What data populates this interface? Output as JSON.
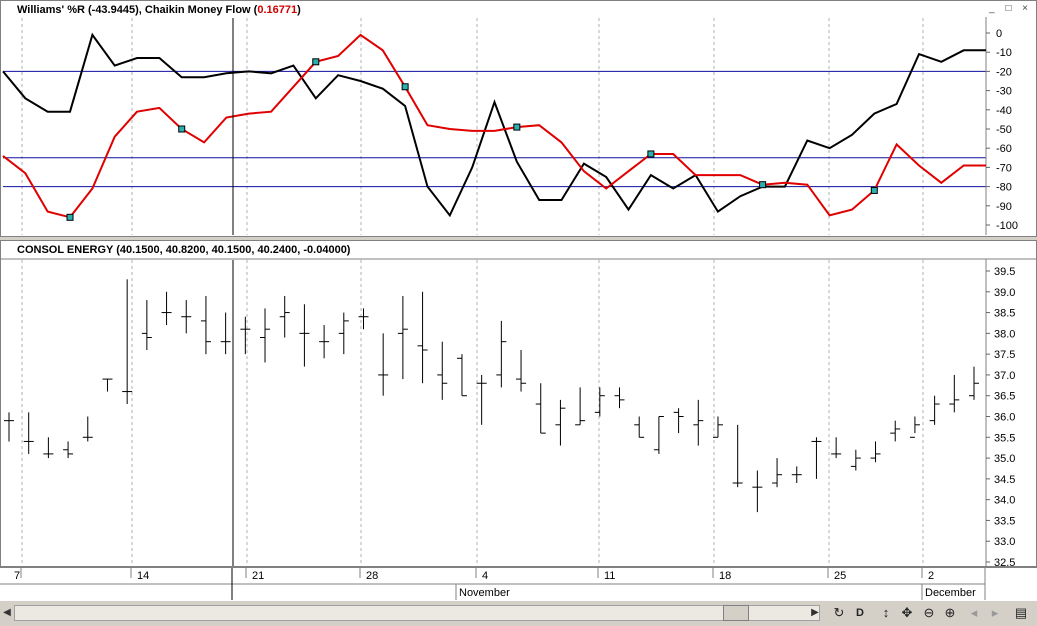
{
  "upper_title": {
    "name1": "Williams' %R (",
    "val1": "-43.9445",
    "mid": "), Chaikin Money Flow (",
    "val2": "0.16771",
    "end": ")"
  },
  "lower_title": "CONSOL ENERGY (40.1500, 40.8200, 40.1500, 40.2400, -0.04000)",
  "window_buttons": "_ □ ×",
  "date_labels": [
    "7",
    "14",
    "21",
    "28",
    "4",
    "11",
    "18",
    "25",
    "2"
  ],
  "month_labels": [
    "November",
    "December"
  ],
  "toolbar": {
    "d_label": "D"
  },
  "chart_data": [
    {
      "type": "line",
      "title": "Williams' %R (-43.9445), Chaikin Money Flow (0.16771)",
      "ylim": [
        -100,
        0
      ],
      "yticks": [
        0,
        -10,
        -20,
        -30,
        -40,
        -50,
        -60,
        -70,
        -80,
        -90,
        -100
      ],
      "reference_lines": [
        -20,
        -65,
        -80
      ],
      "grid": "vertical dashed",
      "series": [
        {
          "color": "#000000",
          "values": [
            -20,
            -34,
            -41,
            -41,
            -1,
            -17,
            -13,
            -13,
            -23,
            -23,
            -21,
            -20,
            -21,
            -17,
            -34,
            -22,
            -25,
            -29,
            -38,
            -80,
            -95,
            -70,
            -36,
            -67,
            -87,
            -87,
            -68,
            -75,
            -92,
            -74,
            -81,
            -74,
            -93,
            -85,
            -80,
            -80,
            -56,
            -60,
            -53,
            -42,
            -37,
            -11,
            -15,
            -9,
            -9
          ]
        },
        {
          "color": "#e00000",
          "values": [
            -64,
            -73,
            -93,
            -96,
            -81,
            -54,
            -41,
            -39,
            -50,
            -57,
            -44,
            -42,
            -41,
            -28,
            -15,
            -12,
            -1,
            -9,
            -28,
            -48,
            -50,
            -51,
            -51,
            -49,
            -48,
            -57,
            -72,
            -81,
            -72,
            -63,
            -63,
            -74,
            -74,
            -74,
            -79,
            -78,
            -79,
            -95,
            -92,
            -82,
            -58,
            -69,
            -78,
            -69,
            -69
          ]
        }
      ]
    },
    {
      "type": "ohlc",
      "title": "CONSOL ENERGY (40.1500, 40.8200, 40.1500, 40.2400, -0.04000)",
      "ylim": [
        32.5,
        39.5
      ],
      "yticks": [
        39.5,
        39.0,
        38.5,
        38.0,
        37.5,
        37.0,
        36.5,
        36.0,
        35.5,
        35.0,
        34.5,
        34.0,
        33.5,
        33.0,
        32.5
      ],
      "bars": [
        [
          35.9,
          36.1,
          35.4,
          35.9
        ],
        [
          35.4,
          36.1,
          35.1,
          35.4
        ],
        [
          35.1,
          35.5,
          35.0,
          35.1
        ],
        [
          35.2,
          35.4,
          35.0,
          35.1
        ],
        [
          35.5,
          36.0,
          35.4,
          35.5
        ],
        [
          36.9,
          36.9,
          36.6,
          36.9
        ],
        [
          36.6,
          39.3,
          36.3,
          36.6
        ],
        [
          38.0,
          38.8,
          37.6,
          37.9
        ],
        [
          38.5,
          39.0,
          38.2,
          38.5
        ],
        [
          38.4,
          38.8,
          38.0,
          38.4
        ],
        [
          38.3,
          38.9,
          37.5,
          37.8
        ],
        [
          37.8,
          38.5,
          37.5,
          37.8
        ],
        [
          38.1,
          38.4,
          37.5,
          38.1
        ],
        [
          37.9,
          38.6,
          37.3,
          38.1
        ],
        [
          38.4,
          38.9,
          37.9,
          38.5
        ],
        [
          38.0,
          38.7,
          37.2,
          38.0
        ],
        [
          37.8,
          38.2,
          37.4,
          37.8
        ],
        [
          38.0,
          38.5,
          37.5,
          38.3
        ],
        [
          38.4,
          38.6,
          38.1,
          38.4
        ],
        [
          37.0,
          38.0,
          36.5,
          37.0
        ],
        [
          38.0,
          38.9,
          36.9,
          38.1
        ],
        [
          37.7,
          39.0,
          36.8,
          37.6
        ],
        [
          37.0,
          37.8,
          36.4,
          36.8
        ],
        [
          37.4,
          37.5,
          36.5,
          36.5
        ],
        [
          36.8,
          37.0,
          35.8,
          36.8
        ],
        [
          37.0,
          38.3,
          36.7,
          37.8
        ],
        [
          36.9,
          37.6,
          36.6,
          36.8
        ],
        [
          36.3,
          36.8,
          35.6,
          35.6
        ],
        [
          35.8,
          36.4,
          35.3,
          36.2
        ],
        [
          35.8,
          36.7,
          35.8,
          35.9
        ],
        [
          36.1,
          36.7,
          36.0,
          36.5
        ],
        [
          36.5,
          36.7,
          36.2,
          36.4
        ],
        [
          35.8,
          36.0,
          35.5,
          35.5
        ],
        [
          35.2,
          36.0,
          35.1,
          36.0
        ],
        [
          36.1,
          36.2,
          35.6,
          36.0
        ],
        [
          35.8,
          36.4,
          35.3,
          35.9
        ],
        [
          35.5,
          36.0,
          35.5,
          35.8
        ],
        [
          34.4,
          35.8,
          34.3,
          34.4
        ],
        [
          34.3,
          34.7,
          33.7,
          34.3
        ],
        [
          34.4,
          35.0,
          34.3,
          34.6
        ],
        [
          34.6,
          34.8,
          34.4,
          34.6
        ],
        [
          35.4,
          35.5,
          34.5,
          35.4
        ],
        [
          35.1,
          35.5,
          35.0,
          35.1
        ],
        [
          34.8,
          35.2,
          34.7,
          35.0
        ],
        [
          35.0,
          35.4,
          34.9,
          35.1
        ],
        [
          35.6,
          35.9,
          35.4,
          35.7
        ],
        [
          35.5,
          36.0,
          35.6,
          35.8
        ],
        [
          35.9,
          36.5,
          35.8,
          36.3
        ],
        [
          36.3,
          37.0,
          36.1,
          36.4
        ],
        [
          36.5,
          37.2,
          36.4,
          36.8
        ]
      ]
    }
  ]
}
